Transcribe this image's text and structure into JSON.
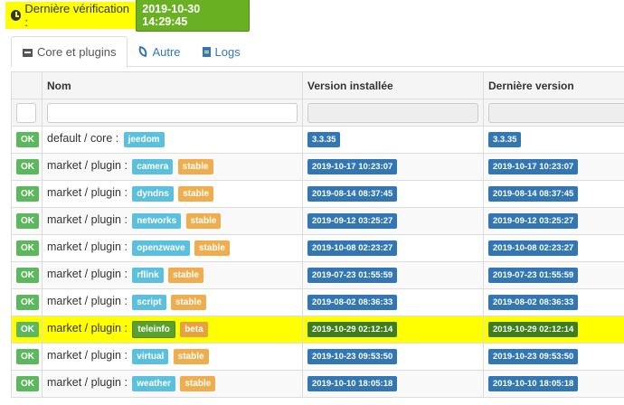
{
  "check": {
    "label": "Dernière vérification :",
    "value": "2019-10-30 14:29:45"
  },
  "tabs": [
    {
      "label": "Core et plugins",
      "icon": "archive-icon"
    },
    {
      "label": "Autre",
      "icon": "feather-icon"
    },
    {
      "label": "Logs",
      "icon": "file-icon"
    }
  ],
  "table": {
    "headers": [
      "",
      "Nom",
      "Version installée",
      "Dernière version"
    ],
    "rows": [
      {
        "status": "OK",
        "name": "default / core :",
        "tag": "jeedom",
        "channel": "",
        "installed": "3.3.35",
        "latest": "3.3.35"
      },
      {
        "status": "OK",
        "name": "market / plugin :",
        "tag": "camera",
        "channel": "stable",
        "installed": "2019-10-17 10:23:07",
        "latest": "2019-10-17 10:23:07"
      },
      {
        "status": "OK",
        "name": "market / plugin :",
        "tag": "dyndns",
        "channel": "stable",
        "installed": "2019-08-14 08:37:45",
        "latest": "2019-08-14 08:37:45"
      },
      {
        "status": "OK",
        "name": "market / plugin :",
        "tag": "networks",
        "channel": "stable",
        "installed": "2019-09-12 03:25:27",
        "latest": "2019-09-12 03:25:27"
      },
      {
        "status": "OK",
        "name": "market / plugin :",
        "tag": "openzwave",
        "channel": "stable",
        "installed": "2019-10-08 02:23:27",
        "latest": "2019-10-08 02:23:27"
      },
      {
        "status": "OK",
        "name": "market / plugin :",
        "tag": "rflink",
        "channel": "stable",
        "installed": "2019-07-23 01:55:59",
        "latest": "2019-07-23 01:55:59"
      },
      {
        "status": "OK",
        "name": "market / plugin :",
        "tag": "script",
        "channel": "stable",
        "installed": "2019-08-02 08:36:33",
        "latest": "2019-08-02 08:36:33"
      },
      {
        "status": "OK",
        "name": "market / plugin :",
        "tag": "teleinfo",
        "channel": "beta",
        "installed": "2019-10-29 02:12:14",
        "latest": "2019-10-29 02:12:14",
        "highlight": true
      },
      {
        "status": "OK",
        "name": "market / plugin :",
        "tag": "virtual",
        "channel": "stable",
        "installed": "2019-10-23 09:53:50",
        "latest": "2019-10-23 09:53:50"
      },
      {
        "status": "OK",
        "name": "market / plugin :",
        "tag": "weather",
        "channel": "stable",
        "installed": "2019-10-10 18:05:18",
        "latest": "2019-10-10 18:05:18"
      }
    ]
  },
  "colors": {
    "ok": "#5cb85c",
    "info": "#5bc0de",
    "stable": "#f0ad4e",
    "version": "#3277b3",
    "highlight": "#ffff00"
  }
}
